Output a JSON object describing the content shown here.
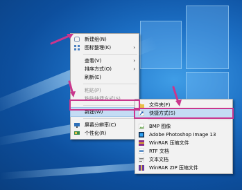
{
  "context_menu": {
    "items": [
      {
        "label": "新建组(N)",
        "icon": "new-group-icon"
      },
      {
        "label": "图标整理(K)",
        "icon": "arrange-icon",
        "submenu": true
      },
      {
        "separator": true
      },
      {
        "label": "查看(V)",
        "submenu": true
      },
      {
        "label": "排序方式(O)",
        "submenu": true
      },
      {
        "label": "刷新(E)"
      },
      {
        "separator": true
      },
      {
        "label": "粘贴(P)",
        "disabled": true
      },
      {
        "label": "粘贴快捷方式(S)",
        "disabled": true
      },
      {
        "separator": true
      },
      {
        "label": "新建(W)",
        "submenu": true,
        "highlighted": true
      },
      {
        "separator": true
      },
      {
        "label": "屏幕分辨率(C)",
        "icon": "screen-resolution-icon"
      },
      {
        "label": "个性化(R)",
        "icon": "personalize-icon"
      }
    ]
  },
  "submenu": {
    "items": [
      {
        "label": "文件夹(F)",
        "icon": "folder-icon"
      },
      {
        "label": "快捷方式(S)",
        "icon": "shortcut-icon",
        "highlighted": true
      },
      {
        "separator": true
      },
      {
        "label": "BMP 图像",
        "icon": "bmp-icon"
      },
      {
        "label": "Adobe Photoshop Image 13",
        "icon": "photoshop-icon"
      },
      {
        "label": "WinRAR 压缩文件",
        "icon": "winrar-icon"
      },
      {
        "label": "RTF 文档",
        "icon": "rtf-icon"
      },
      {
        "label": "文本文档",
        "icon": "text-document-icon"
      },
      {
        "label": "WinRAR ZIP 压缩文件",
        "icon": "winrar-zip-icon"
      }
    ]
  },
  "colors": {
    "annotation": "#c9368d",
    "highlight": "#c4dcf4",
    "menu_bg": "#f2f2f2"
  }
}
